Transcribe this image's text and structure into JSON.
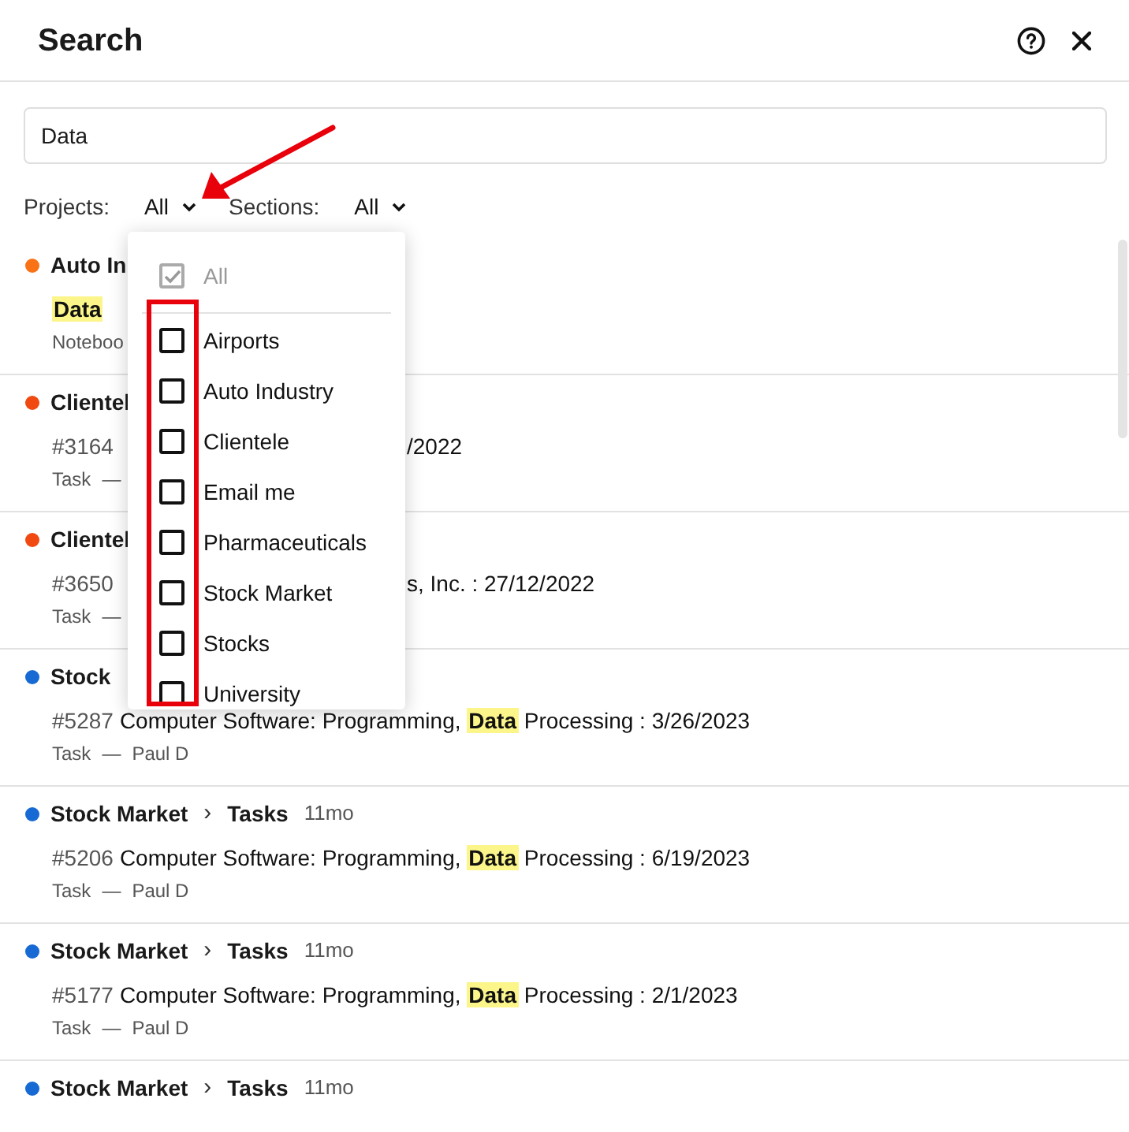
{
  "dialog": {
    "title": "Search"
  },
  "search": {
    "value": "Data"
  },
  "filters": [
    {
      "label": "Projects:",
      "value": "All"
    },
    {
      "label": "Sections:",
      "value": "All"
    }
  ],
  "results": [
    {
      "color": "#f97316",
      "project": "Auto In",
      "body": "**Data**",
      "meta": [
        "Noteboo"
      ]
    },
    {
      "color": "#f04a12",
      "project": "Clientel",
      "number": "#3164",
      "tail": "/2022",
      "meta": [
        "Task",
        "—"
      ]
    },
    {
      "color": "#f04a12",
      "project": "Clientel",
      "number": "#3650",
      "tail": "s, Inc. : 27/12/2022",
      "meta": [
        "Task",
        "—"
      ]
    },
    {
      "color": "#1769d4",
      "project": "Stock",
      "number": "#5287",
      "body": "Computer Software: Programming, **Data** Processing : 3/26/2023",
      "meta": [
        "Task",
        "—",
        "Paul D"
      ]
    },
    {
      "color": "#1769d4",
      "project": "Stock Market",
      "separator": "›",
      "section": "Tasks",
      "time": "11mo",
      "number": "#5206",
      "body": "Computer Software: Programming, **Data** Processing : 6/19/2023",
      "meta": [
        "Task",
        "—",
        "Paul D"
      ]
    },
    {
      "color": "#1769d4",
      "project": "Stock Market",
      "separator": "›",
      "section": "Tasks",
      "time": "11mo",
      "number": "#5177",
      "body": "Computer Software: Programming, **Data** Processing : 2/1/2023",
      "meta": [
        "Task",
        "—",
        "Paul D"
      ]
    },
    {
      "color": "#1769d4",
      "project": "Stock Market",
      "separator": "›",
      "section": "Tasks",
      "time": "11mo"
    }
  ],
  "dropdown": {
    "options": [
      {
        "label": "All",
        "checked": true,
        "disabled": true
      },
      {
        "label": "Airports",
        "checked": false,
        "disabled": false
      },
      {
        "label": "Auto Industry",
        "checked": false,
        "disabled": false
      },
      {
        "label": "Clientele",
        "checked": false,
        "disabled": false
      },
      {
        "label": "Email me",
        "checked": false,
        "disabled": false
      },
      {
        "label": "Pharmaceuticals",
        "checked": false,
        "disabled": false
      },
      {
        "label": "Stock Market",
        "checked": false,
        "disabled": false
      },
      {
        "label": "Stocks",
        "checked": false,
        "disabled": false
      },
      {
        "label": "University",
        "checked": false,
        "disabled": false
      }
    ]
  }
}
